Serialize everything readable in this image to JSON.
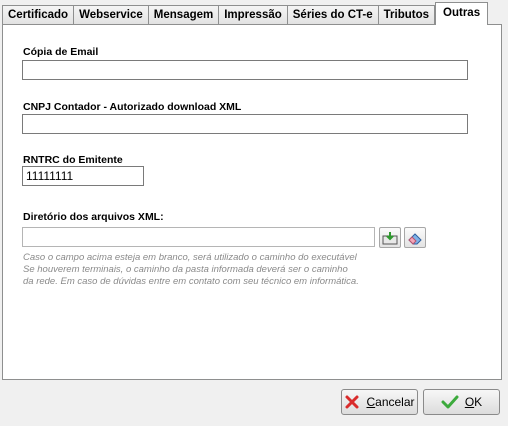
{
  "tabs": [
    "Certificado",
    "Webservice",
    "Mensagem",
    "Impressão",
    "Séries do CT-e",
    "Tributos",
    "Outras"
  ],
  "active_tab": "Outras",
  "fields": {
    "email_copy": {
      "label": "Cópia de  Email",
      "value": ""
    },
    "cnpj_contador": {
      "label": "CNPJ Contador - Autorizado download XML",
      "value": ""
    },
    "rntrc": {
      "label": "RNTRC do Emitente",
      "value": "11111111"
    },
    "xml_dir": {
      "label": "Diretório dos arquivos XML:",
      "value": ""
    }
  },
  "hint_lines": [
    "Caso o campo acima esteja em branco, será utilizado o caminho do executável",
    "Se houverem terminais, o caminho da pasta informada deverá ser o caminho",
    "da rede. Em caso de dúvidas entre em contato com seu técnico em informática."
  ],
  "buttons": {
    "cancel": "Cancelar",
    "ok": "OK"
  },
  "icons": {
    "browse": "folder-browse-icon",
    "clear": "eraser-icon",
    "cancel": "red-x-icon",
    "ok": "green-check-icon"
  }
}
